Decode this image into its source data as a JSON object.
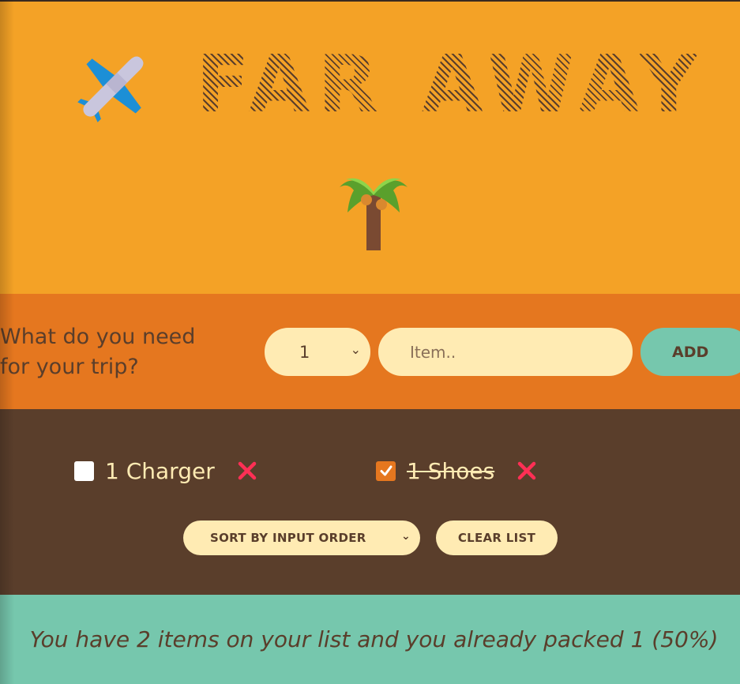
{
  "header": {
    "title": "FAR AWAY",
    "plane_icon": "airplane-icon",
    "palm_icon": "palm-tree-icon"
  },
  "form": {
    "prompt_line1": "What do you need",
    "prompt_line2": "for your trip?",
    "quantity_value": "1",
    "item_placeholder": "Item..",
    "add_label": "ADD"
  },
  "list": {
    "items": [
      {
        "label": "1 Charger",
        "packed": false
      },
      {
        "label": "1 Shoes",
        "packed": true
      }
    ],
    "sort_label": "SORT BY INPUT ORDER",
    "clear_label": "CLEAR LIST"
  },
  "stats": {
    "text": "You have 2 items on your list and you already packed 1 (50%)"
  },
  "colors": {
    "header_bg": "#f4a226",
    "form_bg": "#e5771f",
    "list_bg": "#5a3e2b",
    "stats_bg": "#76c7ad",
    "cream": "#ffebb3",
    "delete": "#ff2f55"
  }
}
